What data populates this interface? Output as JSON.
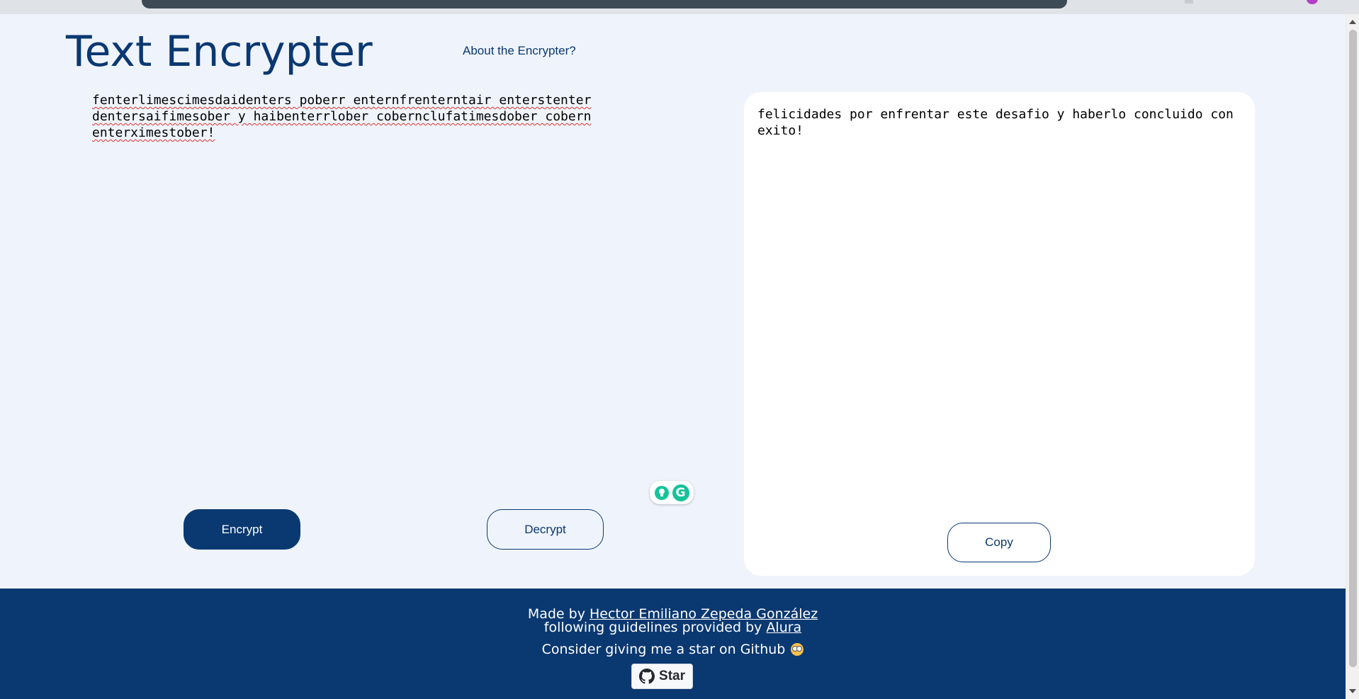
{
  "app": {
    "title": "Text Encrypter",
    "about_link": "About the Encrypter?"
  },
  "input": {
    "value_line1": "fenterlimescimesdaidenters poberr enternfrenterntair enterstenter",
    "value_line2": "dentersaifimesober y haibenterrlober cobernclufatimesdober cobern",
    "value_line3": "enterximestober!"
  },
  "actions": {
    "encrypt_label": "Encrypt",
    "decrypt_label": "Decrypt"
  },
  "output": {
    "text": "felicidades por enfrentar este desafio y haberlo concluido con exito!",
    "copy_label": "Copy"
  },
  "footer": {
    "made_by_prefix": "Made by ",
    "author": "Hector Emiliano Zepeda González",
    "guidelines_prefix": "following guidelines provided by ",
    "guidelines_org": "Alura",
    "star_prompt": "Consider giving me a star on Github ",
    "star_button": "Star"
  },
  "colors": {
    "primary": "#0a3871",
    "background": "#eff4fc",
    "card": "#ffffff",
    "grammarly": "#15c39a"
  },
  "icons": [
    "lightbulb-icon",
    "grammarly-icon",
    "github-icon",
    "emoji-icon"
  ]
}
